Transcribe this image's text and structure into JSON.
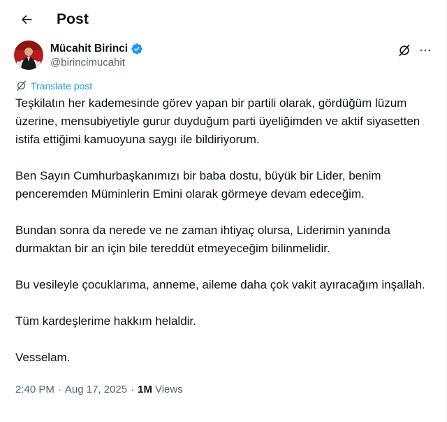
{
  "header": {
    "title": "Post"
  },
  "author": {
    "name": "Mücahit Birinci",
    "handle": "@birincimucahit"
  },
  "translate_label": "Translate post",
  "paragraphs": [
    "Teşkilatın her kademesinde görev yapan bir partili olarak, gördüğüm lüzum üzerine, mensubiyetiyle gurur duyduğum parti üyeliğimden ve aktif siyasetten istifa ettiğimi kamuoyuna saygı ile bildiriyorum.",
    "Ben Sayın Cumhurbaşkanımızı bir baba dostu, büyük bir Lider, benim penceremden Müminlerin Emini olarak görmeye devam edeceğim.",
    "Bundan sonra da nerede ve ne zaman ihtiyaç olursa, Liderimin yanında durmaktan bir an için bile tereddüt etmeyeceğim bilinmelidir.",
    "Bu vesileyle çocuklarıma, anneme, aileme daha çok vakit ayıracağım inşallah.",
    "Tüm kardeşlerime hakkım helaldir.",
    "Vesselam."
  ],
  "meta": {
    "time": "2:40 PM",
    "separator": "·",
    "date": "Aug 17, 2025",
    "views_count": "1M",
    "views_label": "Views"
  },
  "colors": {
    "accent": "#1d9bf0",
    "secondary_text": "#536471",
    "primary_text": "#0f1419"
  },
  "icons": {
    "back": "arrow-left-icon",
    "verified": "verified-badge-icon",
    "grok": "grok-icon",
    "more": "more-horizontal-icon",
    "translate": "translate-icon"
  }
}
